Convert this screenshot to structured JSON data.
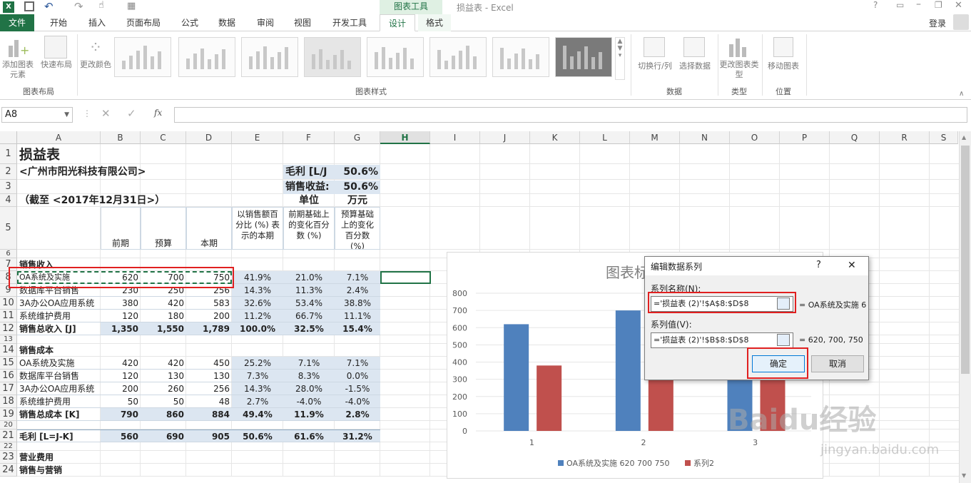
{
  "window": {
    "title": "损益表 - Excel",
    "context_tab": "图表工具",
    "login": "登录"
  },
  "tabs": [
    "文件",
    "开始",
    "插入",
    "页面布局",
    "公式",
    "数据",
    "审阅",
    "视图",
    "开发工具",
    "设计",
    "格式"
  ],
  "ribbon": {
    "add_element": "添加图表元素",
    "quick_layout": "快速布局",
    "change_color": "更改颜色",
    "group_layout": "图表布局",
    "group_styles": "图表样式",
    "switch": "切换行/列",
    "select_data": "选择数据",
    "group_data": "数据",
    "change_type": "更改图表类型",
    "group_type": "类型",
    "move": "移动图表",
    "group_location": "位置"
  },
  "formula": {
    "namebox": "A8",
    "fx": "fx",
    "value": ""
  },
  "columns": [
    "A",
    "B",
    "C",
    "D",
    "E",
    "F",
    "G",
    "H",
    "I",
    "J",
    "K",
    "L",
    "M",
    "N",
    "O",
    "P",
    "Q",
    "R",
    "S"
  ],
  "rows": [
    "1",
    "2",
    "3",
    "4",
    "5",
    "6",
    "7",
    "8",
    "9",
    "10",
    "11",
    "12",
    "13",
    "14",
    "15",
    "16",
    "17",
    "18",
    "19",
    "20",
    "21",
    "22",
    "23",
    "24"
  ],
  "sheet": {
    "title": "损益表",
    "company": "<广州市阳光科技有限公司>",
    "date": "（截至 <2017年12月31日>）",
    "gross_label": "毛利 [L/J",
    "gross_val": "50.6%",
    "rev_label": "销售收益:",
    "rev_val": "50.6%",
    "unit_label": "单位",
    "unit_val": "万元",
    "h_prev": "前期",
    "h_budget": "预算",
    "h_cur": "本期",
    "h_e": "以销售额百分比 (%) 表示的本期",
    "h_f": "前期基础上的变化百分数 (%)",
    "h_g": "预算基础上的变化百分数 (%)",
    "sec_rev": "销售收入",
    "sec_cost": "销售成本",
    "sec_op": "营业费用",
    "sec_sales": "销售与营销",
    "data": [
      {
        "r": 8,
        "a": "OA系统及实施",
        "b": "620",
        "c": "700",
        "d": "750",
        "e": "41.9%",
        "f": "21.0%",
        "g": "7.1%",
        "bold": false
      },
      {
        "r": 9,
        "a": "数据库平台销售",
        "b": "230",
        "c": "250",
        "d": "256",
        "e": "14.3%",
        "f": "11.3%",
        "g": "2.4%",
        "bold": false
      },
      {
        "r": 10,
        "a": "3A办公OA应用系统",
        "b": "380",
        "c": "420",
        "d": "583",
        "e": "32.6%",
        "f": "53.4%",
        "g": "38.8%",
        "bold": false
      },
      {
        "r": 11,
        "a": "系统维护费用",
        "b": "120",
        "c": "180",
        "d": "200",
        "e": "11.2%",
        "f": "66.7%",
        "g": "11.1%",
        "bold": false
      },
      {
        "r": 12,
        "a": "销售总收入 [J]",
        "b": "1,350",
        "c": "1,550",
        "d": "1,789",
        "e": "100.0%",
        "f": "32.5%",
        "g": "15.4%",
        "bold": true
      },
      {
        "r": 15,
        "a": "OA系统及实施",
        "b": "420",
        "c": "420",
        "d": "450",
        "e": "25.2%",
        "f": "7.1%",
        "g": "7.1%",
        "bold": false
      },
      {
        "r": 16,
        "a": "数据库平台销售",
        "b": "120",
        "c": "130",
        "d": "130",
        "e": "7.3%",
        "f": "8.3%",
        "g": "0.0%",
        "bold": false
      },
      {
        "r": 17,
        "a": "3A办公OA应用系统",
        "b": "200",
        "c": "260",
        "d": "256",
        "e": "14.3%",
        "f": "28.0%",
        "g": "-1.5%",
        "bold": false
      },
      {
        "r": 18,
        "a": "系统维护费用",
        "b": "50",
        "c": "50",
        "d": "48",
        "e": "2.7%",
        "f": "-4.0%",
        "g": "-4.0%",
        "bold": false
      },
      {
        "r": 19,
        "a": "销售总成本 [K]",
        "b": "790",
        "c": "860",
        "d": "884",
        "e": "49.4%",
        "f": "11.9%",
        "g": "2.8%",
        "bold": true
      },
      {
        "r": 21,
        "a": "毛利 [L=J-K]",
        "b": "560",
        "c": "690",
        "d": "905",
        "e": "50.6%",
        "f": "61.6%",
        "g": "31.2%",
        "bold": true
      }
    ]
  },
  "chart_data": {
    "type": "bar",
    "title": "图表标",
    "categories": [
      "1",
      "2",
      "3"
    ],
    "series": [
      {
        "name": "OA系统及实施 620 700 750",
        "values": [
          620,
          700,
          750
        ],
        "color": "#4f81bd"
      },
      {
        "name": "系列2",
        "values": [
          380,
          420,
          300
        ],
        "color": "#c0504d"
      }
    ],
    "ylim": [
      0,
      800
    ],
    "yticks": [
      "0",
      "100",
      "200",
      "300",
      "400",
      "500",
      "600",
      "700",
      "800"
    ],
    "legend": "bottom"
  },
  "dialog": {
    "title": "编辑数据系列",
    "help": "?",
    "close": "✕",
    "name_label": "系列名称(N):",
    "name_value": "='损益表 (2)'!$A$8:$D$8",
    "name_result": "= OA系统及实施 6",
    "values_label": "系列值(V):",
    "values_value": "='损益表 (2)'!$B$8:$D$8",
    "values_result": "= 620, 700, 750",
    "ok": "确定",
    "cancel": "取消"
  },
  "watermark": "Baidu经验",
  "watermark_url": "jingyan.baidu.com"
}
